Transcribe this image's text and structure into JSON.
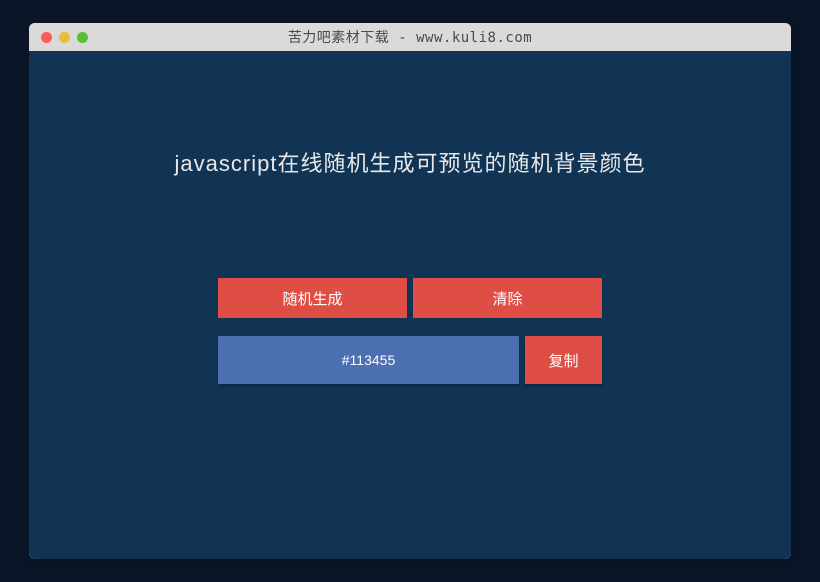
{
  "window": {
    "title": "苦力吧素材下载 - www.kuli8.com"
  },
  "heading": "javascript在线随机生成可预览的随机背景颜色",
  "buttons": {
    "generate": "随机生成",
    "clear": "清除",
    "copy": "复制"
  },
  "color_value": "#113455",
  "colors": {
    "preview_bg": "#113455",
    "button_primary": "#de4e45",
    "input_bg": "#4c6fb1"
  }
}
